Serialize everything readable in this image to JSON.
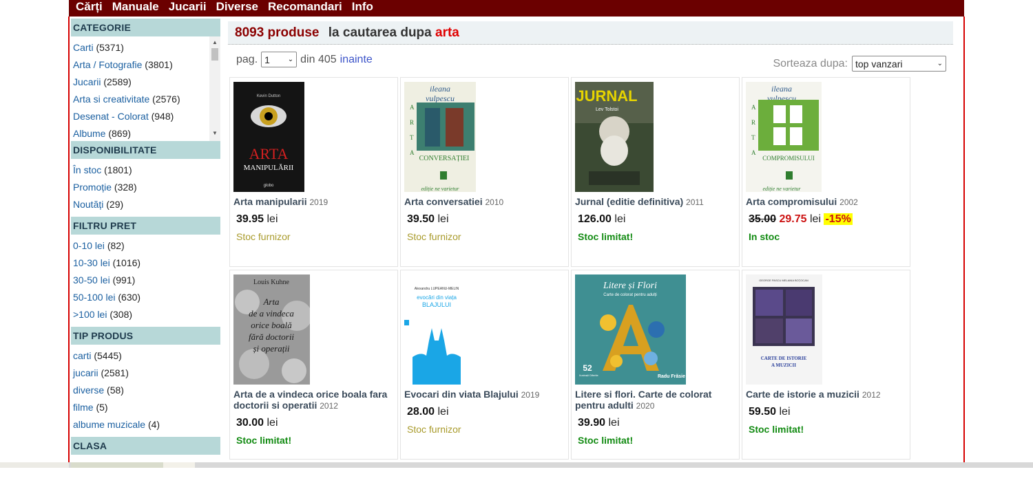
{
  "nav": [
    "Cărți",
    "Manuale",
    "Jucarii",
    "Diverse",
    "Recomandari",
    "Info"
  ],
  "sidebar": {
    "categorie": {
      "title": "CATEGORIE",
      "items": [
        {
          "label": "Carti",
          "count": "(5371)"
        },
        {
          "label": "Arta / Fotografie",
          "count": "(3801)"
        },
        {
          "label": "Jucarii",
          "count": "(2589)"
        },
        {
          "label": "Arta si creativitate",
          "count": "(2576)"
        },
        {
          "label": "Desenat - Colorat",
          "count": "(948)"
        },
        {
          "label": "Albume",
          "count": "(869)"
        }
      ]
    },
    "disponibilitate": {
      "title": "DISPONIBILITATE",
      "items": [
        {
          "label": "În stoc",
          "count": "(1801)"
        },
        {
          "label": "Promoție",
          "count": "(328)"
        },
        {
          "label": "Noutăți",
          "count": "(29)"
        }
      ]
    },
    "filtru_pret": {
      "title": "FILTRU PRET",
      "items": [
        {
          "label": "0-10 lei",
          "count": "(82)"
        },
        {
          "label": "10-30 lei",
          "count": "(1016)"
        },
        {
          "label": "30-50 lei",
          "count": "(991)"
        },
        {
          "label": "50-100 lei",
          "count": "(630)"
        },
        {
          "label": ">100 lei",
          "count": "(308)"
        }
      ]
    },
    "tip_produs": {
      "title": "TIP PRODUS",
      "items": [
        {
          "label": "carti",
          "count": "(5445)"
        },
        {
          "label": "jucarii",
          "count": "(2581)"
        },
        {
          "label": "diverse",
          "count": "(58)"
        },
        {
          "label": "filme",
          "count": "(5)"
        },
        {
          "label": "albume muzicale",
          "count": "(4)"
        }
      ]
    },
    "clasa": {
      "title": "CLASA"
    }
  },
  "results": {
    "count": "8093 produse",
    "middle": "la cautarea dupa",
    "term": "arta"
  },
  "pager": {
    "pag_label": "pag.",
    "page": "1",
    "of": "din 405",
    "next": "inainte",
    "sort_label": "Sorteaza dupa:",
    "sort_value": "top vanzari"
  },
  "products": [
    {
      "title": "Arta manipularii",
      "year": "2019",
      "price": "39.95",
      "currency": "lei",
      "stock": "Stoc furnizor",
      "stock_type": "furn",
      "cover": {
        "bg": "#141414",
        "fg": "#d42020",
        "text": "ARTA",
        "sub": "MANIPULĂRII",
        "author": "Kevin Dutton",
        "publisher": "globo",
        "style": "eye"
      }
    },
    {
      "title": "Arta conversatiei",
      "year": "2010",
      "price": "39.50",
      "currency": "lei",
      "stock": "Stoc furnizor",
      "stock_type": "furn",
      "cover": {
        "bg": "#efefe2",
        "fg": "#2f7d2f",
        "author": "ileana vulpescu",
        "vertical": "ARTA",
        "text": "CONVERSAȚIEI",
        "tagline": "ediție ne varietur",
        "style": "vulpescu-conv"
      }
    },
    {
      "title": "Jurnal (editie definitiva)",
      "year": "2011",
      "price": "126.00",
      "currency": "lei",
      "stock": "Stoc limitat!",
      "stock_type": "lim",
      "cover": {
        "bg": "#3b4a33",
        "fg": "#e6d400",
        "text": "JURNAL",
        "author": "Lev Tolstoi",
        "style": "jurnal"
      }
    },
    {
      "title": "Arta compromisului",
      "year": "2002",
      "price_old": "35.00",
      "price": "29.75",
      "currency": "lei",
      "discount": "-15%",
      "stock": "In stoc",
      "stock_type": "ok",
      "cover": {
        "bg": "#f4f4ee",
        "fg": "#2f7d2f",
        "author": "ileana vulpescu",
        "vertical": "ARTA",
        "text": "COMPROMISULUI",
        "tagline": "ediție ne varietur",
        "style": "vulpescu-comp"
      }
    },
    {
      "title": "Arta de a vindeca orice boala fara doctorii si operatii",
      "year": "2012",
      "price": "30.00",
      "currency": "lei",
      "stock": "Stoc limitat!",
      "stock_type": "lim",
      "cover": {
        "bg": "#9a9a9a",
        "fg": "#1a1a1a",
        "author": "Louis Kuhne",
        "text": "Arta de a vindeca orice boală fără doctorii și operații",
        "style": "kuhne"
      }
    },
    {
      "title": "Evocari din viata Blajului",
      "year": "2019",
      "price": "28.00",
      "currency": "lei",
      "stock": "Stoc furnizor",
      "stock_type": "furn",
      "cover": {
        "bg": "#ffffff",
        "fg": "#1aa6e6",
        "author": "Alexandru LUPEANU-MELIN",
        "text": "BLAJULUI",
        "sub": "evocări din viața",
        "style": "blaj"
      }
    },
    {
      "title": "Litere si flori. Carte de colorat pentru adulti",
      "year": "2020",
      "price": "39.90",
      "currency": "lei",
      "stock": "Stoc limitat!",
      "stock_type": "lim",
      "cover": {
        "bg": "#3f8f92",
        "fg": "#ffffff",
        "text": "Litere și Flori",
        "sub": "Carte de colorat pentru adulți",
        "num": "52",
        "num_sub": "Ilustrații Diferite",
        "author": "Radu Frăsie",
        "style": "litere"
      }
    },
    {
      "title": "Carte de istorie a muzicii",
      "year": "2012",
      "price": "59.50",
      "currency": "lei",
      "stock": "Stoc limitat!",
      "stock_type": "lim",
      "cover": {
        "bg": "#ffffff",
        "fg": "#2a3f9a",
        "author": "GEORGE PASCU    MELANIA BOŢOCAN",
        "text": "CARTE DE ISTORIE A MUZICII",
        "style": "muzica"
      }
    }
  ],
  "colors": {
    "nav_bg": "#6b0000",
    "frame": "#d60000",
    "header_bg": "#b7d8d8",
    "link": "#1a5fa0",
    "stock_ok": "#118a11",
    "stock_furn": "#a89a2a"
  }
}
